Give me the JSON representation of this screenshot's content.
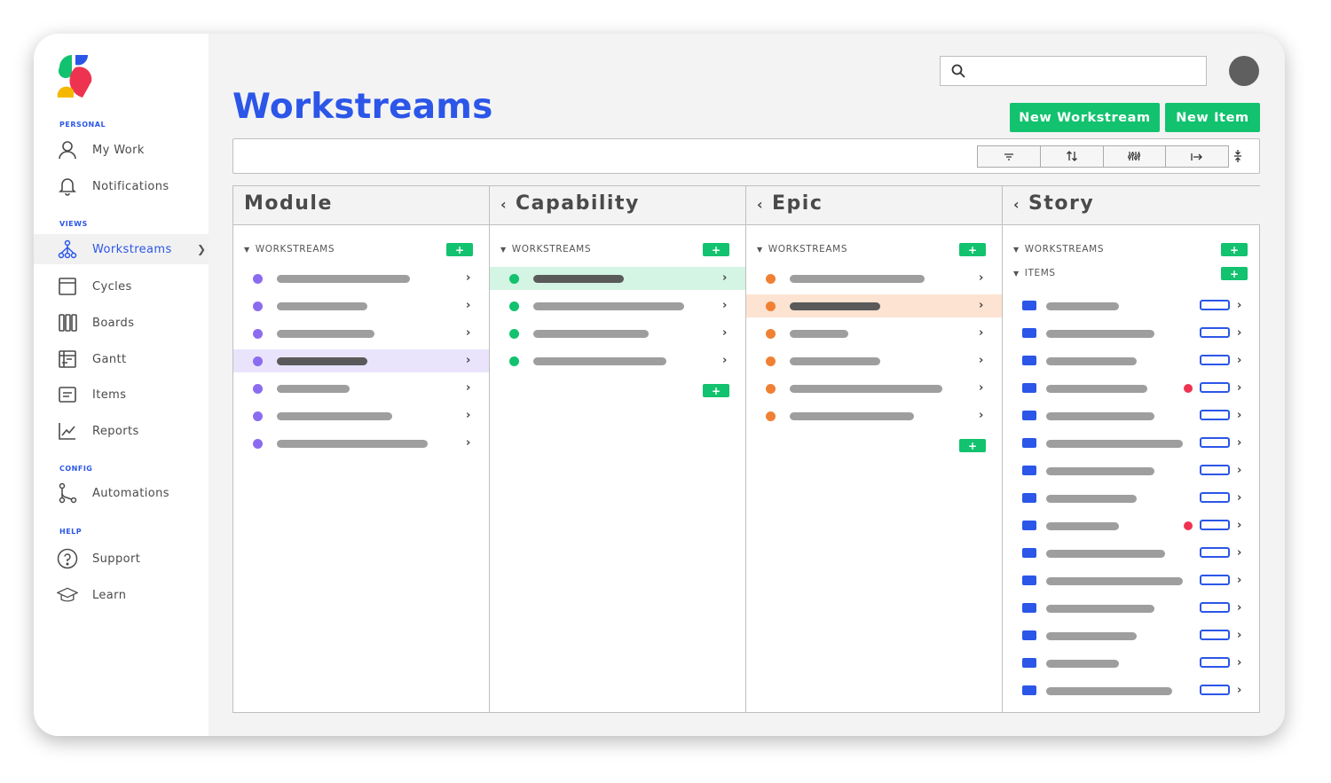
{
  "sidebar": {
    "sections": [
      {
        "label": "PERSONAL",
        "items": [
          {
            "label": "My Work",
            "icon": "user-icon"
          },
          {
            "label": "Notifications",
            "icon": "bell-icon"
          }
        ]
      },
      {
        "label": "VIEWS",
        "items": [
          {
            "label": "Workstreams",
            "icon": "workstreams-icon",
            "active": true
          },
          {
            "label": "Cycles",
            "icon": "cycles-icon"
          },
          {
            "label": "Boards",
            "icon": "boards-icon"
          },
          {
            "label": "Gantt",
            "icon": "gantt-icon"
          },
          {
            "label": "Items",
            "icon": "items-icon"
          },
          {
            "label": "Reports",
            "icon": "reports-icon"
          }
        ]
      },
      {
        "label": "CONFIG",
        "items": [
          {
            "label": "Automations",
            "icon": "automations-icon"
          }
        ]
      },
      {
        "label": "HELP",
        "items": [
          {
            "label": "Support",
            "icon": "help-circle-icon"
          },
          {
            "label": "Learn",
            "icon": "graduation-cap-icon"
          }
        ]
      }
    ]
  },
  "header": {
    "title": "Workstreams",
    "new_workstream_label": "New Workstream",
    "new_item_label": "New Item"
  },
  "colors": {
    "accent": "#2b56e8",
    "green": "#12c26e",
    "purple": "#8b6cf0",
    "orange": "#f08134",
    "red": "#ee3350"
  },
  "board": {
    "columns": [
      {
        "title": "Module",
        "group_label": "WORKSTREAMS",
        "row_color": "#8b6cf0",
        "selected_row": 3,
        "rows": 7
      },
      {
        "title": "Capability",
        "group_label": "WORKSTREAMS",
        "row_color": "#12c26e",
        "selected_row": 0,
        "rows": 4
      },
      {
        "title": "Epic",
        "group_label": "WORKSTREAMS",
        "row_color": "#f08134",
        "selected_row": 1,
        "rows": 6
      },
      {
        "title": "Story",
        "group_label": "WORKSTREAMS",
        "items_label": "ITEMS",
        "row_color": "#2b56e8",
        "rows": 15,
        "flagged_rows": [
          3,
          8
        ]
      }
    ],
    "plus_label": "+"
  }
}
